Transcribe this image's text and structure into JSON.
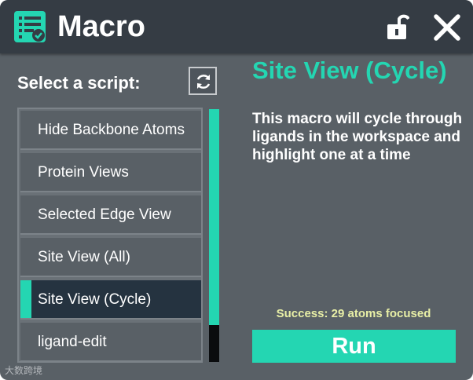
{
  "window": {
    "title": "Macro",
    "icons": {
      "app": "script-list-check-icon",
      "lock": "unlock-icon",
      "close": "close-icon"
    }
  },
  "sidebar": {
    "label": "Select a script:",
    "refresh_icon": "refresh-icon",
    "items": [
      {
        "label": "Hide Backbone Atoms",
        "selected": false
      },
      {
        "label": "Protein Views",
        "selected": false
      },
      {
        "label": "Selected Edge View",
        "selected": false
      },
      {
        "label": "Site View (All)",
        "selected": false
      },
      {
        "label": "Site View (Cycle)",
        "selected": true
      },
      {
        "label": "ligand-edit",
        "selected": false
      }
    ]
  },
  "detail": {
    "title": "Site View (Cycle)",
    "description": "This macro will cycle through ligands in the workspace and highlight one at a time",
    "status": "Success: 29 atoms focused",
    "run_label": "Run"
  },
  "watermark": "大数跨境",
  "colors": {
    "accent": "#24d6b2",
    "panel": "#596066",
    "titlebar": "#353c44",
    "selected_item": "#253340",
    "status_text": "#e8efa6"
  }
}
